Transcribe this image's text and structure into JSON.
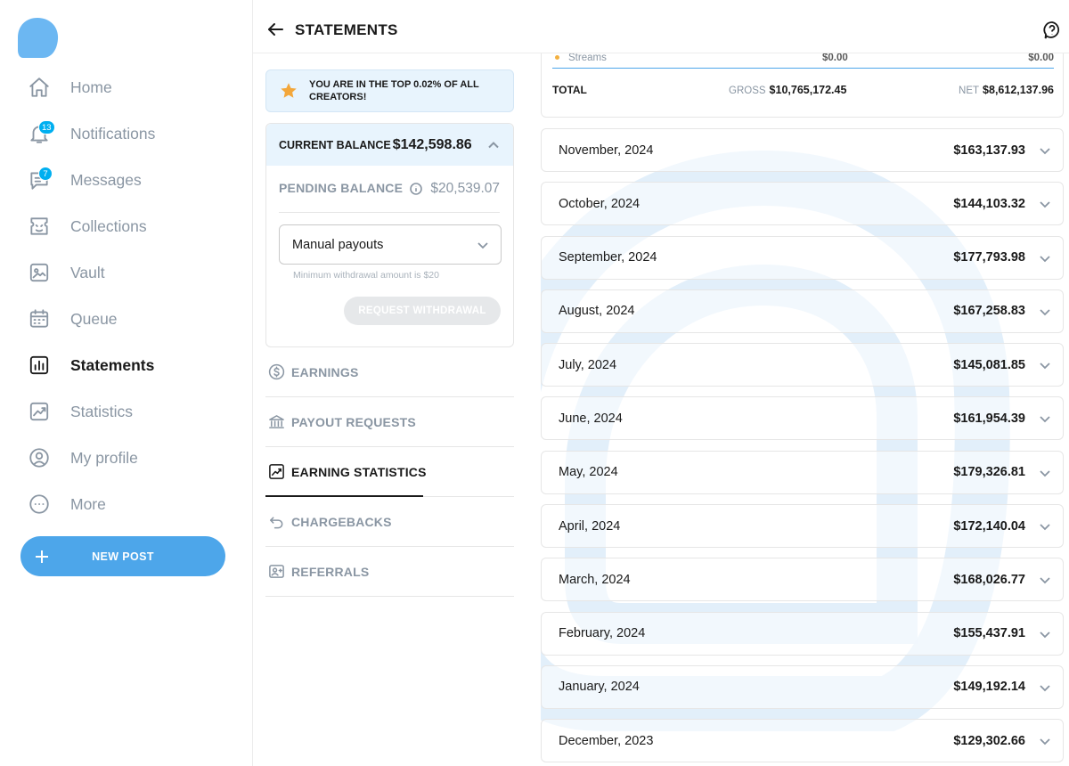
{
  "sidebar": {
    "items": [
      {
        "label": "Home",
        "icon": "home-icon"
      },
      {
        "label": "Notifications",
        "icon": "bell-icon",
        "badge": "13"
      },
      {
        "label": "Messages",
        "icon": "message-icon",
        "badge": "7"
      },
      {
        "label": "Collections",
        "icon": "collections-icon"
      },
      {
        "label": "Vault",
        "icon": "vault-icon"
      },
      {
        "label": "Queue",
        "icon": "calendar-icon"
      },
      {
        "label": "Statements",
        "icon": "statements-icon",
        "active": true
      },
      {
        "label": "Statistics",
        "icon": "statistics-icon"
      },
      {
        "label": "My profile",
        "icon": "profile-icon"
      },
      {
        "label": "More",
        "icon": "more-icon"
      }
    ],
    "new_post_label": "NEW POST"
  },
  "header": {
    "title": "STATEMENTS"
  },
  "banner": {
    "text": "YOU ARE IN THE TOP 0.02% OF ALL CREATORS!"
  },
  "balance": {
    "current_label": "CURRENT BALANCE",
    "current_amount": "$142,598.86",
    "pending_label": "PENDING BALANCE",
    "pending_amount": "$20,539.07",
    "payout_method": "Manual payouts",
    "min_note": "Minimum withdrawal amount is $20",
    "withdraw_label": "REQUEST WITHDRAWAL"
  },
  "menu": [
    {
      "label": "EARNINGS",
      "icon": "dollar-circle-icon"
    },
    {
      "label": "PAYOUT REQUESTS",
      "icon": "bank-icon"
    },
    {
      "label": "EARNING STATISTICS",
      "icon": "chart-icon",
      "active": true
    },
    {
      "label": "CHARGEBACKS",
      "icon": "undo-icon"
    },
    {
      "label": "REFERRALS",
      "icon": "referral-icon"
    }
  ],
  "summary": {
    "streams_label": "Streams",
    "streams_gross": "$0.00",
    "streams_net": "$0.00",
    "total_label": "TOTAL",
    "gross_tag": "GROSS",
    "gross_value": "$10,765,172.45",
    "net_tag": "NET",
    "net_value": "$8,612,137.96"
  },
  "months": [
    {
      "name": "November, 2024",
      "amount": "$163,137.93"
    },
    {
      "name": "October, 2024",
      "amount": "$144,103.32"
    },
    {
      "name": "September, 2024",
      "amount": "$177,793.98"
    },
    {
      "name": "August, 2024",
      "amount": "$167,258.83"
    },
    {
      "name": "July, 2024",
      "amount": "$145,081.85"
    },
    {
      "name": "June, 2024",
      "amount": "$161,954.39"
    },
    {
      "name": "May, 2024",
      "amount": "$179,326.81"
    },
    {
      "name": "April, 2024",
      "amount": "$172,140.04"
    },
    {
      "name": "March, 2024",
      "amount": "$168,026.77"
    },
    {
      "name": "February, 2024",
      "amount": "$155,437.91"
    },
    {
      "name": "January, 2024",
      "amount": "$149,192.14"
    },
    {
      "name": "December, 2023",
      "amount": "$129,302.66"
    }
  ],
  "colors": {
    "accent": "#4da6ea",
    "banner_bg": "#e8f4fd",
    "muted": "#8a96a3",
    "star": "#f3a73b"
  }
}
